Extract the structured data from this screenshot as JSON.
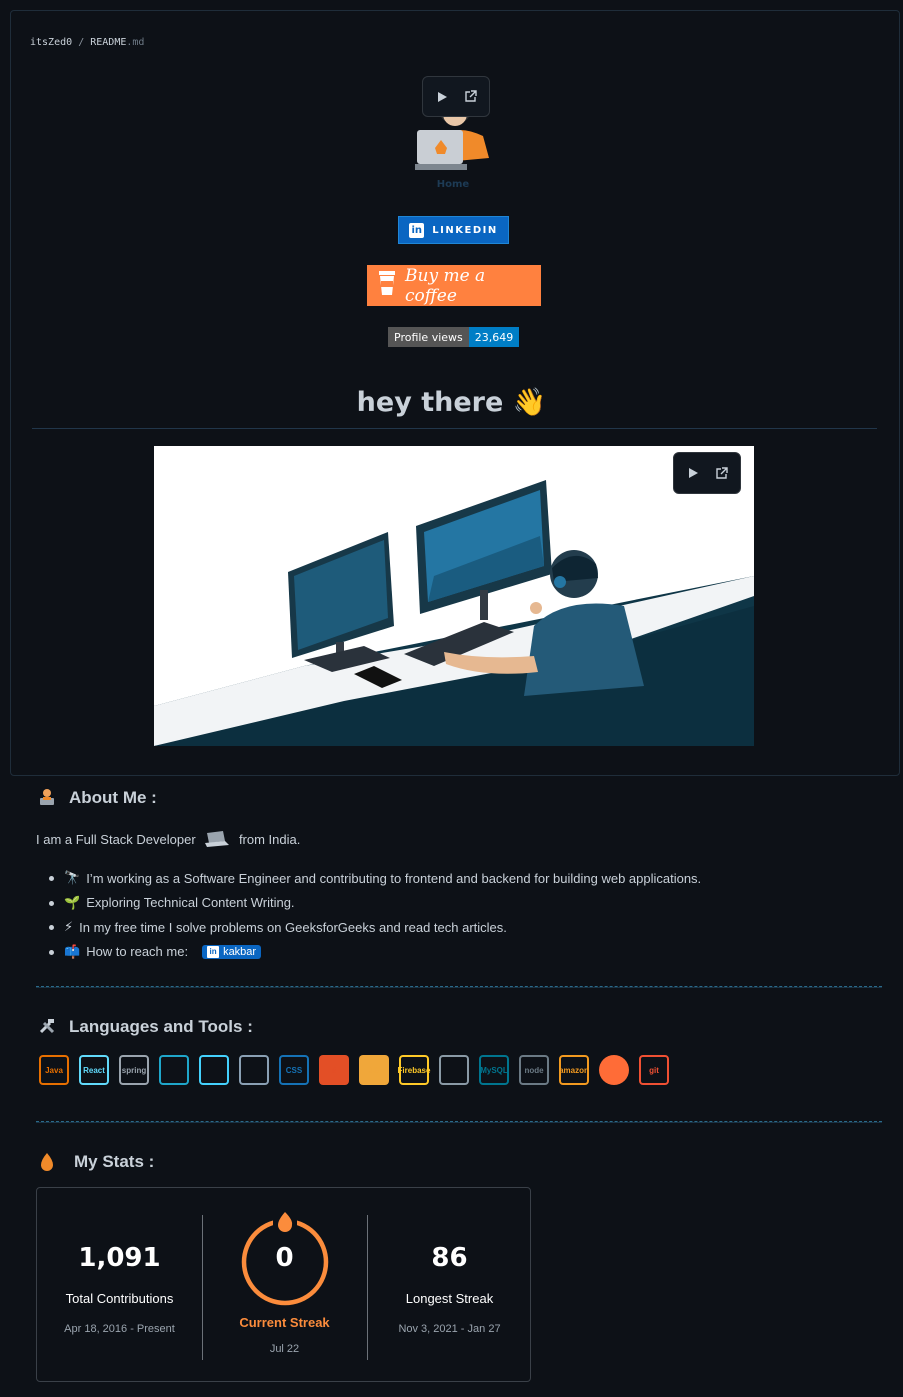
{
  "breadcrumb": {
    "owner": "itsZed0",
    "separator": "/",
    "file": "README",
    "ext": ".md"
  },
  "avatar": {
    "caption": "Home"
  },
  "media_controls": {
    "play_icon": "play-icon",
    "external_icon": "external-link-icon"
  },
  "linkedin_badge": {
    "label": "LINKEDIN",
    "icon": "in",
    "color": "#0a66c2"
  },
  "coffee_button": {
    "label": "Buy me a coffee",
    "color": "#ff813f"
  },
  "profile_views": {
    "label": "Profile views",
    "count": "23,649"
  },
  "greeting": {
    "text": "hey there",
    "emoji": "👋"
  },
  "about": {
    "title": "About Me :",
    "intro_before": "I am a Full Stack Developer",
    "intro_after": "from India.",
    "items": [
      {
        "emoji": "🔭",
        "text": "I’m working as a Software Engineer and contributing to frontend and backend for building web applications."
      },
      {
        "emoji": "🌱",
        "text": "Exploring Technical Content Writing."
      },
      {
        "emoji": "⚡",
        "text": "In my free time I solve problems on GeeksforGeeks and read tech articles."
      },
      {
        "emoji": "📫",
        "text": "How to reach me:",
        "badge": "kakbar",
        "badge_icon": "in"
      }
    ]
  },
  "languages": {
    "title": "Languages and Tools :",
    "tools": [
      {
        "name": "java",
        "label": "Java",
        "icon": "java-icon",
        "color": "#e76f00"
      },
      {
        "name": "react",
        "label": "React",
        "icon": "react-icon",
        "color": "#61dafb"
      },
      {
        "name": "spring",
        "label": "spring",
        "icon": "spring-icon",
        "color": "#9aa4ae"
      },
      {
        "name": "mui",
        "label": "",
        "icon": "material-ui-icon",
        "color": "#1fa6ca"
      },
      {
        "name": "flutter",
        "label": "",
        "icon": "flutter-icon",
        "color": "#44d1fd"
      },
      {
        "name": "redux",
        "label": "",
        "icon": "redux-icon",
        "color": "#8aa0b4"
      },
      {
        "name": "css3",
        "label": "CSS",
        "icon": "css3-icon",
        "color": "#1572b6"
      },
      {
        "name": "html5",
        "label": "5",
        "icon": "html5-icon",
        "color": "#e34f26"
      },
      {
        "name": "javascript",
        "label": "JS",
        "icon": "javascript-icon",
        "color": "#f0a73a"
      },
      {
        "name": "firebase",
        "label": "Firebase",
        "icon": "firebase-icon",
        "color": "#ffca28"
      },
      {
        "name": "gatsby",
        "label": "",
        "icon": "gatsby-icon",
        "color": "#8a9aa6"
      },
      {
        "name": "mysql",
        "label": "MySQL",
        "icon": "mysql-icon",
        "color": "#00758f"
      },
      {
        "name": "nodejs",
        "label": "node",
        "icon": "nodejs-icon",
        "color": "#6b7a85"
      },
      {
        "name": "aws",
        "label": "amazon",
        "icon": "aws-icon",
        "color": "#f29a20"
      },
      {
        "name": "postman",
        "label": "",
        "icon": "postman-icon",
        "color": "#ff6c37"
      },
      {
        "name": "git",
        "label": "git",
        "icon": "git-icon",
        "color": "#f05033"
      }
    ]
  },
  "stats": {
    "title": "My Stats :",
    "total": {
      "value": "1,091",
      "label": "Total Contributions",
      "range": "Apr 18, 2016 - Present"
    },
    "current": {
      "value": "0",
      "label": "Current Streak",
      "range": "Jul 22",
      "color": "#fb8c3c"
    },
    "longest": {
      "value": "86",
      "label": "Longest Streak",
      "range": "Nov 3, 2021 - Jan 27"
    }
  }
}
